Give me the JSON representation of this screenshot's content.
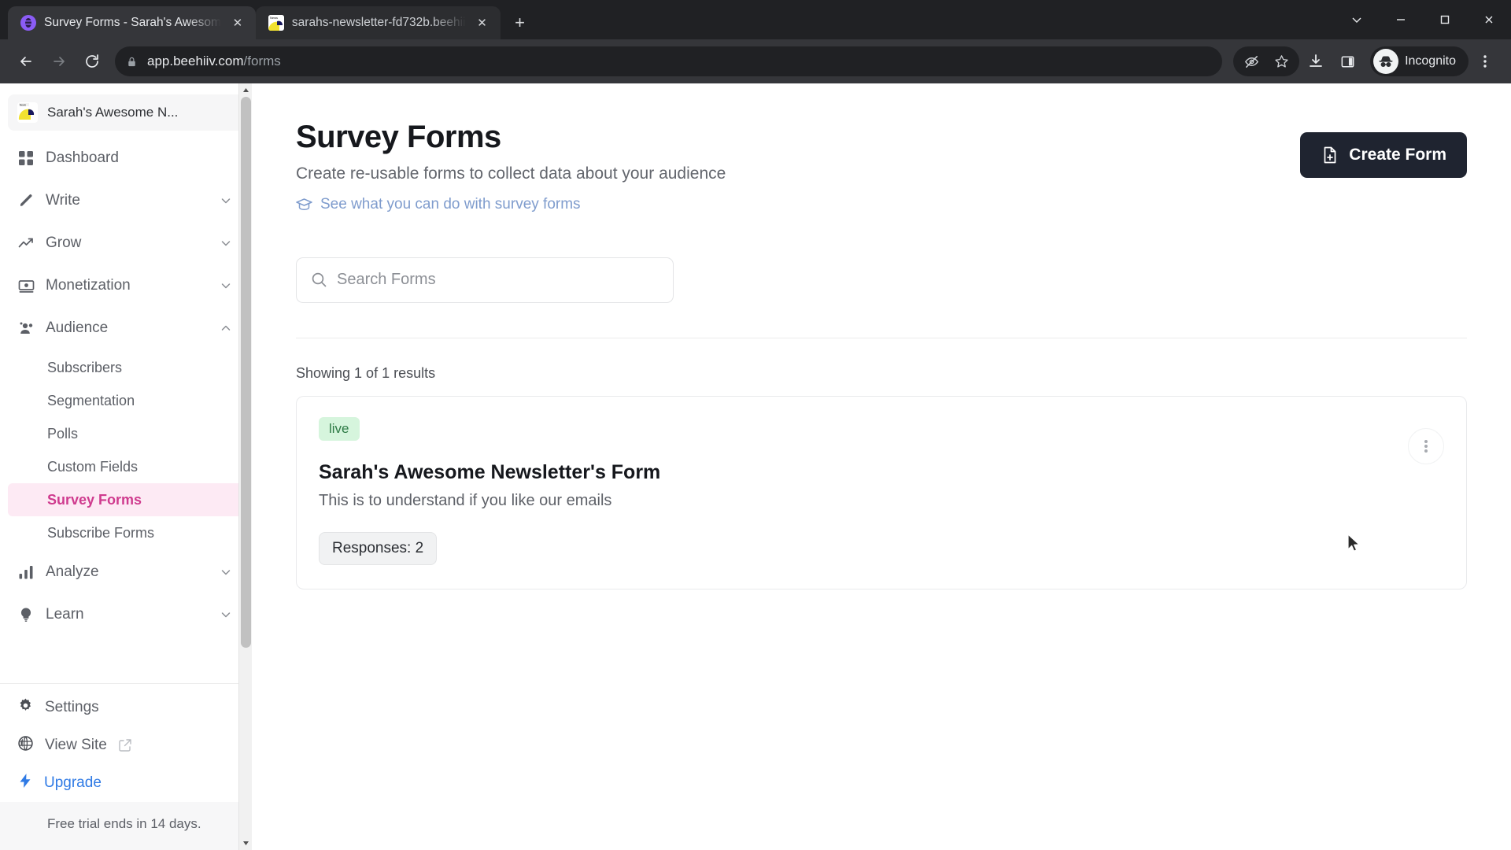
{
  "browser": {
    "tabs": [
      {
        "title": "Survey Forms - Sarah's Awesom",
        "favicon": "beehiiv-icon",
        "active": true,
        "close_label": "✕"
      },
      {
        "title": "sarahs-newsletter-fd732b.beehii",
        "favicon": "newsletter-icon",
        "active": false,
        "close_label": "✕"
      }
    ],
    "new_tab_label": "+",
    "window_controls": {
      "minimize": "⌄",
      "restore": "─",
      "maximize": "□",
      "close": "✕"
    },
    "nav": {
      "back": "back-icon",
      "forward": "forward-icon",
      "reload": "reload-icon"
    },
    "omnibox": {
      "lock": "lock-icon",
      "domain": "app.beehiiv.com",
      "path": "/forms"
    },
    "toolbar_right": {
      "tracking_protection": "eye-off-icon",
      "bookmark": "star-icon",
      "downloads": "download-icon",
      "side_panel": "side-panel-icon",
      "profile_label": "Incognito",
      "menu": "three-dot-menu-icon"
    }
  },
  "sidebar": {
    "brand": {
      "name": "Sarah's Awesome N...",
      "logo": "beehiiv-logo"
    },
    "items": [
      {
        "label": "Dashboard",
        "icon": "grid-icon",
        "expandable": false
      },
      {
        "label": "Write",
        "icon": "pencil-icon",
        "expandable": true,
        "expanded": false
      },
      {
        "label": "Grow",
        "icon": "trending-up-icon",
        "expandable": true,
        "expanded": false
      },
      {
        "label": "Monetization",
        "icon": "money-icon",
        "expandable": true,
        "expanded": false
      },
      {
        "label": "Audience",
        "icon": "users-icon",
        "expandable": true,
        "expanded": true
      }
    ],
    "audience_children": [
      {
        "label": "Subscribers",
        "active": false
      },
      {
        "label": "Segmentation",
        "active": false
      },
      {
        "label": "Polls",
        "active": false
      },
      {
        "label": "Custom Fields",
        "active": false
      },
      {
        "label": "Survey Forms",
        "active": true
      },
      {
        "label": "Subscribe Forms",
        "active": false
      }
    ],
    "items_after": [
      {
        "label": "Analyze",
        "icon": "bar-chart-icon",
        "expandable": true,
        "expanded": false
      },
      {
        "label": "Learn",
        "icon": "lightbulb-icon",
        "expandable": true,
        "expanded": false
      }
    ],
    "bottom": [
      {
        "label": "Settings",
        "icon": "gear-icon",
        "external": false,
        "highlight": false
      },
      {
        "label": "View Site",
        "icon": "globe-icon",
        "external": true,
        "highlight": false
      },
      {
        "label": "Upgrade",
        "icon": "bolt-icon",
        "external": false,
        "highlight": true
      }
    ],
    "trial_notice": "Free trial ends in 14 days.",
    "chevron_down": "⌄",
    "chevron_up": "⌃"
  },
  "page": {
    "title": "Survey Forms",
    "subtitle": "Create re-usable forms to collect data about your audience",
    "help_link": {
      "label": "See what you can do with survey forms",
      "icon": "graduation-cap-icon"
    },
    "create_button": {
      "label": "Create Form",
      "icon": "file-plus-icon"
    },
    "search": {
      "placeholder": "Search Forms",
      "value": "",
      "icon": "search-icon"
    },
    "results_count": "Showing 1 of 1 results",
    "forms": [
      {
        "status": "live",
        "name": "Sarah's Awesome Newsletter's Form",
        "description": "This is to understand if you like our emails",
        "responses_label": "Responses: 2",
        "menu_icon": "kebab-menu-icon"
      }
    ]
  },
  "colors": {
    "accent_pink": "#cf3b8e",
    "accent_pink_bg": "#fdeaf4",
    "button_dark": "#1f2430",
    "link_blue": "#7f9ccd",
    "upgrade_blue": "#2f7ae5",
    "badge_green_bg": "#d6f5dd",
    "badge_green_text": "#2d7a45"
  }
}
